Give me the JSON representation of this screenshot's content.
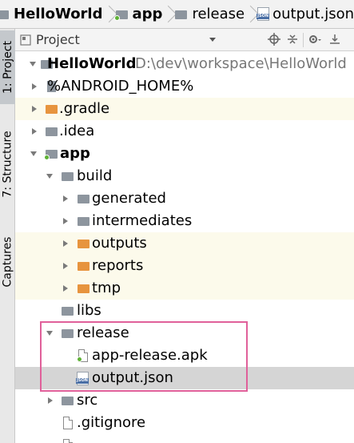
{
  "breadcrumb": [
    {
      "label": "HelloWorld",
      "icon": "folder-icon",
      "bold": true
    },
    {
      "label": "app",
      "icon": "module-folder-icon",
      "bold": true
    },
    {
      "label": "release",
      "icon": "folder-icon",
      "bold": false
    },
    {
      "label": "output.json",
      "icon": "json-file-icon",
      "bold": false
    }
  ],
  "tool_strip": {
    "tabs": [
      {
        "label": "1: Project",
        "active": true
      },
      {
        "label": "7: Structure",
        "active": false
      },
      {
        "label": "Captures",
        "active": false
      }
    ]
  },
  "project_panel": {
    "title": "Project",
    "icons": [
      "target-icon",
      "collapse-icon",
      "gear-icon",
      "hide-icon"
    ]
  },
  "tree": {
    "rows": [
      {
        "name": "HelloWorld",
        "path": "D:\\dev\\workspace\\HelloWorld",
        "expanded": true
      },
      {
        "name": "%ANDROID_HOME%",
        "expanded": false
      },
      {
        "name": ".gradle",
        "expanded": false
      },
      {
        "name": ".idea",
        "expanded": false
      },
      {
        "name": "app",
        "expanded": true
      },
      {
        "name": "build",
        "expanded": true
      },
      {
        "name": "generated",
        "expanded": false
      },
      {
        "name": "intermediates",
        "expanded": false
      },
      {
        "name": "outputs",
        "expanded": false
      },
      {
        "name": "reports",
        "expanded": false
      },
      {
        "name": "tmp",
        "expanded": false
      },
      {
        "name": "libs"
      },
      {
        "name": "release",
        "expanded": true
      },
      {
        "name": "app-release.apk"
      },
      {
        "name": "output.json",
        "selected": true
      },
      {
        "name": "src",
        "expanded": false
      },
      {
        "name": ".gitignore"
      }
    ]
  },
  "colors": {
    "highlight_row": "#fcfaeb",
    "selected_row": "#d5d5d5",
    "callout_border": "#e0609a",
    "folder_grey": "#8d959e",
    "folder_orange": "#e7943e"
  }
}
